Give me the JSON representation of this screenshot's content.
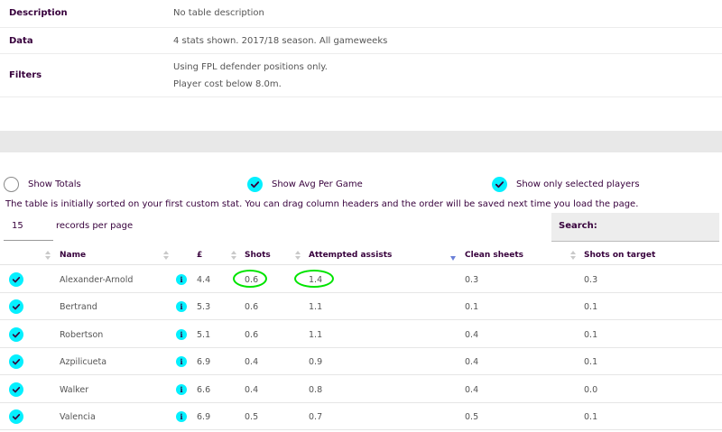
{
  "info": {
    "description_label": "Description",
    "description_value": "No table description",
    "data_label": "Data",
    "data_value": "4 stats shown. 2017/18 season. All gameweeks",
    "filters_label": "Filters",
    "filters_value_1": "Using FPL defender positions only.",
    "filters_value_2": "Player cost below 8.0m."
  },
  "toggles": {
    "show_totals": "Show Totals",
    "show_avg": "Show Avg Per Game",
    "show_selected": "Show only selected players",
    "show_totals_checked": false,
    "show_avg_checked": true,
    "show_selected_checked": true
  },
  "note": "The table is initially sorted on your first custom stat. You can drag column headers and the order will be saved next time you load the page.",
  "per_page": {
    "value": "15",
    "label": "records per page"
  },
  "search": {
    "label": "Search:"
  },
  "table": {
    "headers": {
      "name": "Name",
      "price": "£",
      "shots": "Shots",
      "attempted_assists": "Attempted assists",
      "clean_sheets": "Clean sheets",
      "shots_on_target": "Shots on target"
    },
    "sorted_column": "attempted_assists",
    "rows": [
      {
        "name": "Alexander-Arnold",
        "price": "4.4",
        "shots": "0.6",
        "attempted_assists": "1.4",
        "clean_sheets": "0.3",
        "shots_on_target": "0.3"
      },
      {
        "name": "Bertrand",
        "price": "5.3",
        "shots": "0.6",
        "attempted_assists": "1.1",
        "clean_sheets": "0.1",
        "shots_on_target": "0.1"
      },
      {
        "name": "Robertson",
        "price": "5.1",
        "shots": "0.6",
        "attempted_assists": "1.1",
        "clean_sheets": "0.4",
        "shots_on_target": "0.1"
      },
      {
        "name": "Azpilicueta",
        "price": "6.9",
        "shots": "0.4",
        "attempted_assists": "0.9",
        "clean_sheets": "0.4",
        "shots_on_target": "0.1"
      },
      {
        "name": "Walker",
        "price": "6.6",
        "shots": "0.4",
        "attempted_assists": "0.8",
        "clean_sheets": "0.4",
        "shots_on_target": "0.0"
      },
      {
        "name": "Valencia",
        "price": "6.9",
        "shots": "0.5",
        "attempted_assists": "0.7",
        "clean_sheets": "0.5",
        "shots_on_target": "0.1"
      }
    ]
  },
  "info_icon_glyph": "i",
  "colors": {
    "accent": "#05f0ff",
    "highlight": "#00e400",
    "text": "#37003c"
  }
}
